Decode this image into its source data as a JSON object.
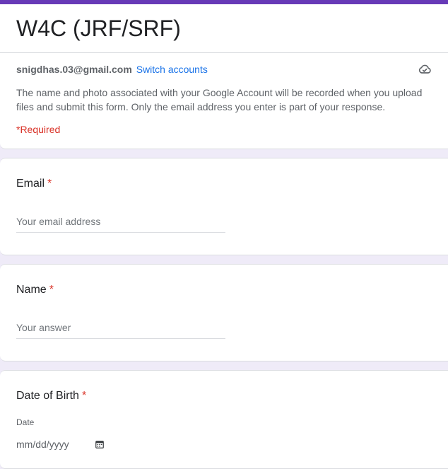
{
  "theme": {
    "accent": "#673ab7",
    "background": "#efebf8",
    "link": "#1a73e8",
    "required": "#d93025"
  },
  "form": {
    "title": "W4C (JRF/SRF)"
  },
  "account": {
    "email": "snigdhas.03@gmail.com",
    "switch_label": "Switch accounts",
    "sync_icon": "cloud-check-icon"
  },
  "notice": {
    "text": "The name and photo associated with your Google Account will be recorded when you upload files and submit this form. Only the email address you enter is part of your response."
  },
  "required_note": "*Required",
  "questions": {
    "email": {
      "label": "Email",
      "star": "*",
      "placeholder": "Your email address"
    },
    "name": {
      "label": "Name",
      "star": "*",
      "placeholder": "Your answer"
    },
    "dob": {
      "label": "Date of Birth",
      "star": "*",
      "sub_label": "Date",
      "placeholder": "mm/dd/yyyy",
      "icon": "calendar-icon"
    }
  }
}
